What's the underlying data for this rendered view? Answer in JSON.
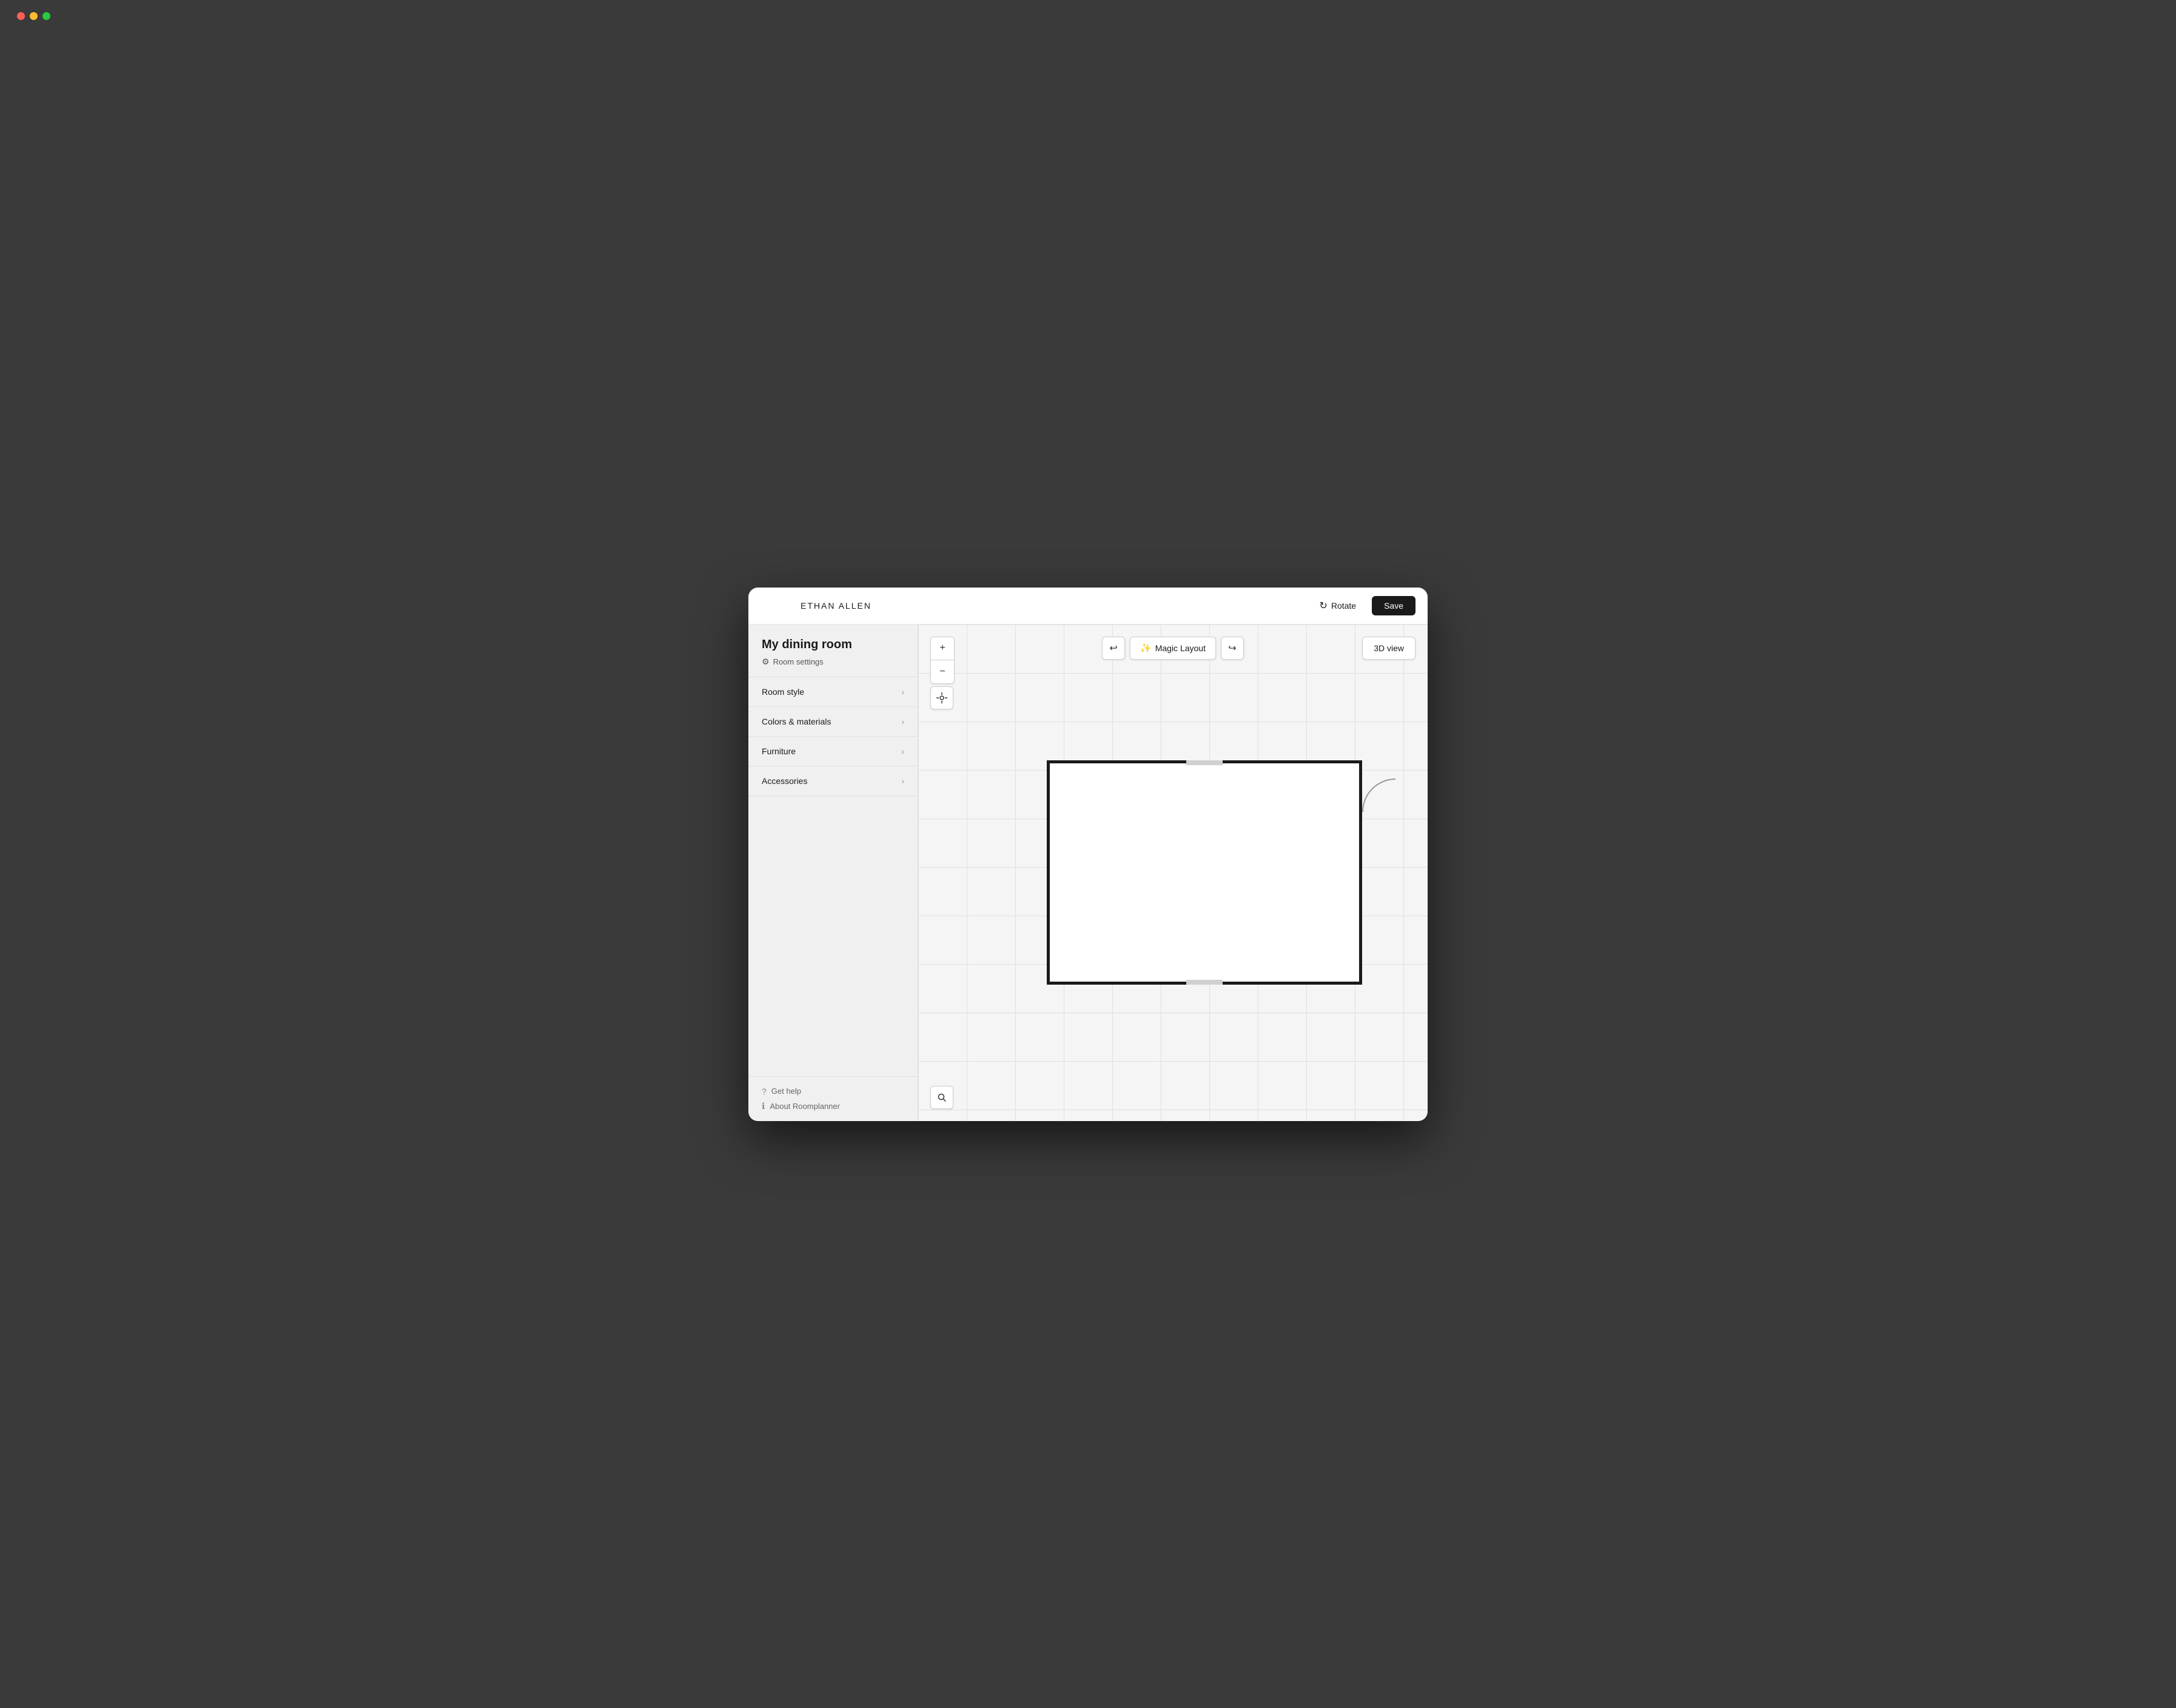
{
  "app": {
    "logo": "ETHAN ALLEN",
    "rotate_label": "Rotate",
    "save_label": "Save"
  },
  "sidebar": {
    "room_title": "My dining room",
    "room_settings_label": "Room settings",
    "nav_items": [
      {
        "id": "room-style",
        "label": "Room style"
      },
      {
        "id": "colors-materials",
        "label": "Colors & materials"
      },
      {
        "id": "furniture",
        "label": "Furniture"
      },
      {
        "id": "accessories",
        "label": "Accessories"
      }
    ],
    "footer_items": [
      {
        "id": "get-help",
        "label": "Get help"
      },
      {
        "id": "about",
        "label": "About Roomplanner"
      }
    ]
  },
  "toolbar": {
    "zoom_in_label": "+",
    "zoom_out_label": "−",
    "center_label": "⊕",
    "undo_label": "↩",
    "redo_label": "↪",
    "magic_layout_label": "Magic Layout",
    "view_3d_label": "3D view",
    "search_label": "🔍"
  }
}
